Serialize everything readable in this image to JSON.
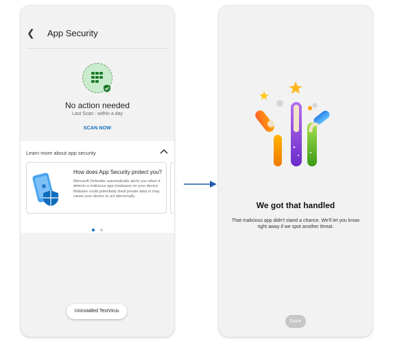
{
  "left_screen": {
    "header": {
      "back_icon": "chevron-left-icon",
      "title": "App Security"
    },
    "status": {
      "icon": "app-grid-shield-icon",
      "title": "No action needed",
      "last_scan": "Last Scan : within a day",
      "scan_button": "SCAN NOW"
    },
    "learn_more": {
      "label": "Learn more about app security",
      "toggle_icon": "chevron-up-icon",
      "card": {
        "title": "How does App Security protect you?",
        "body": "Microsoft Defender automatically alerts you when it detects a malicious app (malware) on your device. Malware could potentially steal private data or may cause your device to act abnormally."
      },
      "page_indicator": {
        "count": 2,
        "active_index": 0
      }
    },
    "toast": "Uninstalled TestVirus"
  },
  "right_screen": {
    "headline": "We got that handled",
    "description": "That malicious app didn't stand a chance. We'll let you know right away if we spot another threat.",
    "done_button": "Done"
  },
  "colors": {
    "accent": "#0f6cbd",
    "success": "#1d7a2a",
    "phone_background": "#f2f2f2"
  }
}
